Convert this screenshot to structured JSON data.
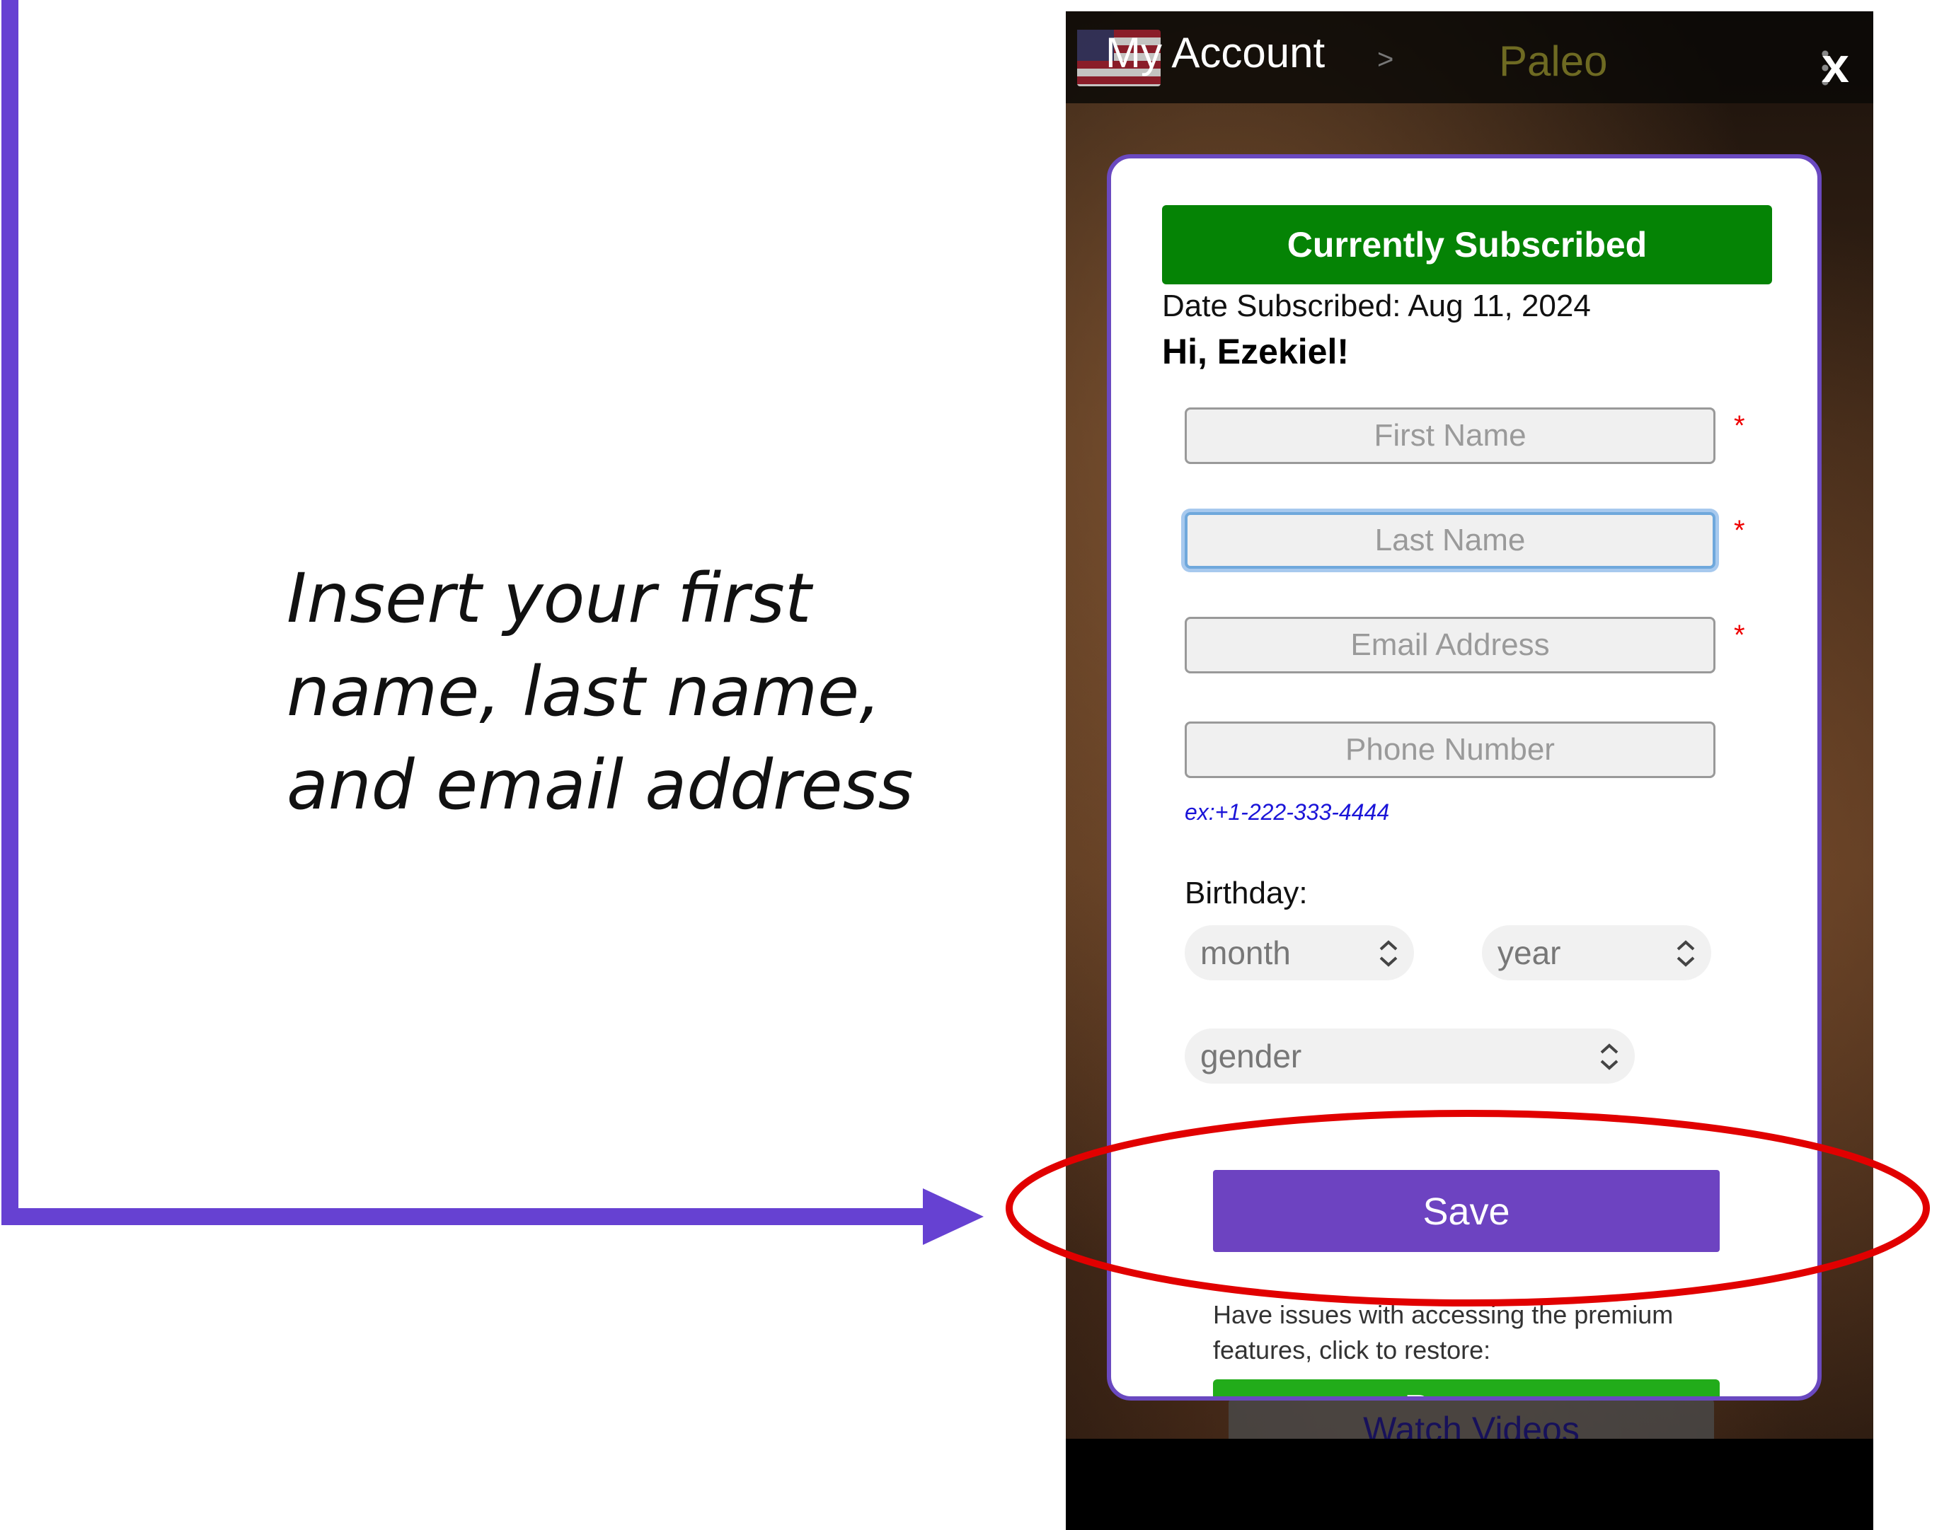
{
  "annotation": {
    "instruction_lines": [
      "Insert your first",
      "name, last name,",
      "and email address"
    ]
  },
  "topbar": {
    "title": "My Account",
    "separator": ">",
    "breadcrumb": "Paleo",
    "close_label": "x"
  },
  "account": {
    "status_banner": "Currently Subscribed",
    "date_subscribed": "Date Subscribed: Aug 11, 2024",
    "greeting": "Hi, Ezekiel!"
  },
  "form": {
    "first_name_placeholder": "First Name",
    "last_name_placeholder": "Last Name",
    "email_placeholder": "Email Address",
    "phone_placeholder": "Phone Number",
    "required_marker": "*",
    "phone_hint": "ex:+1-222-333-4444",
    "birthday_label": "Birthday:",
    "month_value": "month",
    "year_value": "year",
    "gender_value": "gender",
    "save_label": "Save",
    "issues_text": "Have issues with accessing the premium features, click to restore:",
    "restore_label": "Restore"
  },
  "background": {
    "watch_videos_label": "Watch Videos"
  },
  "colors": {
    "accent_purple": "#6d43c1",
    "subscribed_green": "#058305",
    "restore_green": "#22ac1a",
    "highlight_red": "#e10000",
    "hint_blue": "#1a14d8"
  }
}
